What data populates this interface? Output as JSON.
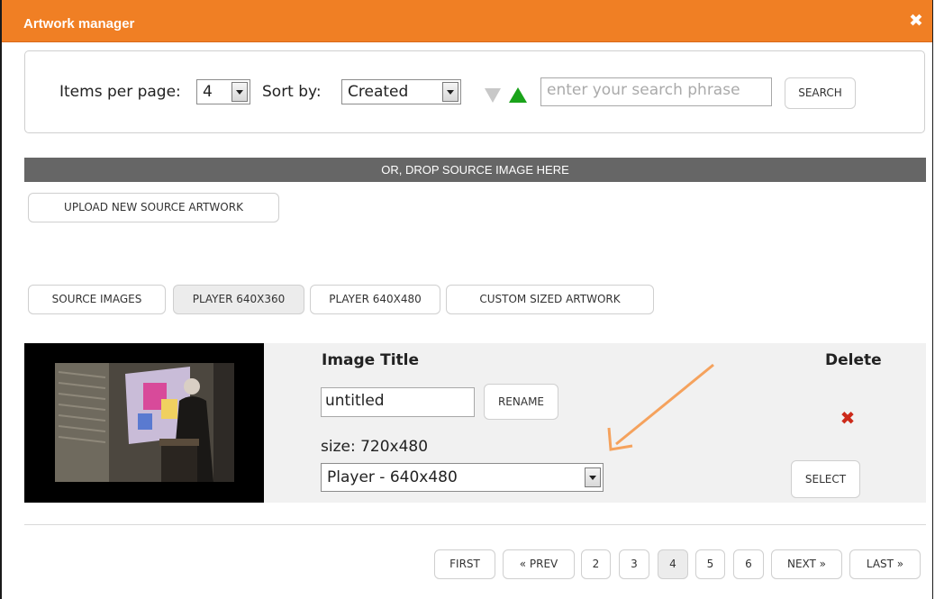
{
  "window": {
    "title": "Artwork manager",
    "close_glyph": "✖",
    "accent_color": "#f07f24"
  },
  "filters": {
    "items_per_page_label": "Items per page:",
    "items_per_page_value": "4",
    "sort_by_label": "Sort by:",
    "sort_by_value": "Created",
    "search_placeholder": "enter your search phrase",
    "search_button": "SEARCH",
    "sort_desc_icon": "triangle-down-icon",
    "sort_asc_icon": "triangle-up-icon"
  },
  "upload": {
    "drop_text": "OR, DROP SOURCE IMAGE HERE",
    "upload_button": "UPLOAD NEW SOURCE ARTWORK"
  },
  "tabs": [
    {
      "label": "SOURCE IMAGES",
      "active": false
    },
    {
      "label": "PLAYER 640X360",
      "active": true
    },
    {
      "label": "PLAYER 640X480",
      "active": false
    },
    {
      "label": "CUSTOM SIZED ARTWORK",
      "active": false
    }
  ],
  "item": {
    "title_heading": "Image Title",
    "title_value": "untitled",
    "rename_button": "RENAME",
    "size_text": "size: 720x480",
    "size_select_value": "Player - 640x480",
    "delete_heading": "Delete",
    "delete_icon": "delete-x-icon",
    "delete_color": "#cc2a1a",
    "select_button": "SELECT"
  },
  "pagination": [
    "FIRST",
    "« PREV",
    "2",
    "3",
    "4",
    "5",
    "6",
    "NEXT »",
    "LAST »"
  ],
  "pagination_current": "4",
  "annotation_color": "#f5a25d"
}
